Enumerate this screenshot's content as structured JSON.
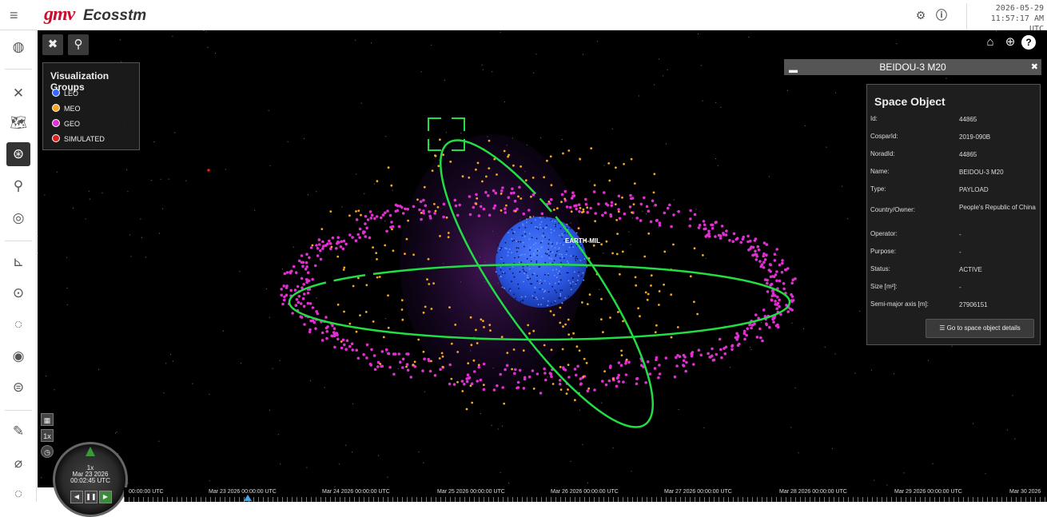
{
  "app": {
    "logo": "gmv",
    "title": "Ecosstm"
  },
  "header": {
    "date": "2026-05-29",
    "time": "11:57:17 AM UTC",
    "settings_icon": "gear-icon",
    "info_icon": "info-icon"
  },
  "sidebar_icons": [
    "globe-icon",
    "satellite-icon",
    "map-icon",
    "orbit-icon",
    "rocket-icon",
    "radar-icon",
    "chart-icon",
    "circle-dot-icon",
    "orbit-path-icon",
    "target-icon",
    "clock-face-icon",
    "pen-icon",
    "satellite-dish-icon",
    "ring-icon"
  ],
  "toolbar": {
    "left": [
      "satellite-tool-icon",
      "rocket-tool-icon"
    ],
    "right": [
      "home-icon",
      "globe-view-icon",
      "help-icon"
    ]
  },
  "legend": {
    "title": "Visualization Groups",
    "items": [
      {
        "label": "LEO",
        "color": "#2f6bff"
      },
      {
        "label": "MEO",
        "color": "#f5a623"
      },
      {
        "label": "GEO",
        "color": "#e030d0"
      },
      {
        "label": "SIMULATED",
        "color": "#e02020"
      }
    ]
  },
  "scene": {
    "earth_label": "EARTH-MIL"
  },
  "infobar": {
    "title": "BEIDOU-3 M20"
  },
  "space_object": {
    "title": "Space Object",
    "rows": [
      {
        "label": "Id:",
        "value": "44865"
      },
      {
        "label": "CosparId:",
        "value": "2019-090B"
      },
      {
        "label": "NoradId:",
        "value": "44865"
      },
      {
        "label": "Name:",
        "value": "BEIDOU-3 M20"
      },
      {
        "label": "Type:",
        "value": "PAYLOAD"
      },
      {
        "label": "Country/Owner:",
        "value": "People's Republic of China"
      },
      {
        "label": "Operator:",
        "value": "-"
      },
      {
        "label": "Purpose:",
        "value": "-"
      },
      {
        "label": "Status:",
        "value": "ACTIVE"
      },
      {
        "label": "Size [m²]:",
        "value": "-"
      },
      {
        "label": "Semi-major axis [m]:",
        "value": "27906151"
      }
    ],
    "details_button": "Go to space object details"
  },
  "clock_widget": {
    "speed": "1x",
    "date": "Mar 23 2026",
    "time": "00:02:45 UTC",
    "mini_speed": "1x"
  },
  "timeline": {
    "labels": [
      "00:00:00 UTC",
      "Mar 23 2026 00:00:00 UTC",
      "Mar 24 2026 00:00:00 UTC",
      "Mar 25 2026 00:00:00 UTC",
      "Mar 26 2026 00:00:00 UTC",
      "Mar 27 2026 00:00:00 UTC",
      "Mar 28 2026 00:00:00 UTC",
      "Mar 29 2026 00:00:00 UTC",
      "Mar 30 2026"
    ]
  }
}
